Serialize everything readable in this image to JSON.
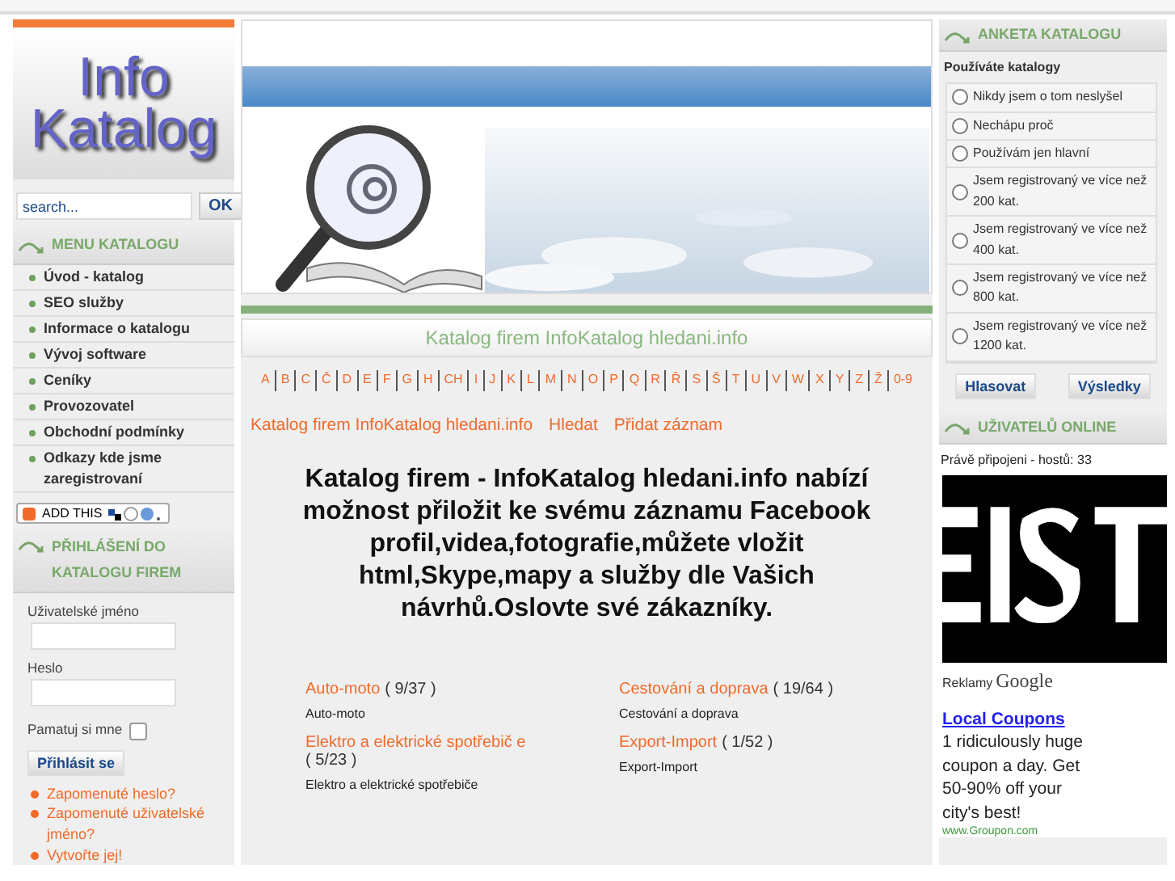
{
  "logo": {
    "line1": "Info",
    "line2": "Katalog"
  },
  "search": {
    "placeholder": "search...",
    "button": "OK"
  },
  "menu": {
    "title": "MENU KATALOGU",
    "items": [
      "Úvod - katalog",
      "SEO služby",
      "Informace o katalogu",
      "Vývoj software",
      "Ceníky",
      "Provozovatel",
      "Obchodní podmínky",
      "Odkazy kde jsme zaregistrovaní"
    ]
  },
  "addthis": {
    "label": "ADD THIS"
  },
  "login": {
    "title": "PŘIHLÁŠENÍ DO KATALOGU FIREM",
    "username_label": "Uživatelské jméno",
    "password_label": "Heslo",
    "remember_label": "Pamatuj si mne",
    "remember_checked": false,
    "submit": "Přihlásit se",
    "links": [
      "Zapomenuté heslo?",
      "Zapomenuté uživatelské jméno?",
      "Vytvořte jej!"
    ]
  },
  "page_title": "Katalog firem InfoKatalog hledani.info",
  "alphabet": [
    "A",
    "B",
    "C",
    "Č",
    "D",
    "E",
    "F",
    "G",
    "H",
    "CH",
    "I",
    "J",
    "K",
    "L",
    "M",
    "N",
    "O",
    "P",
    "Q",
    "R",
    "Ř",
    "S",
    "Š",
    "T",
    "U",
    "V",
    "W",
    "X",
    "Y",
    "Z",
    "Ž",
    "0-9"
  ],
  "nav": [
    "Katalog firem InfoKatalog hledani.info",
    "Hledat",
    "Přidat záznam"
  ],
  "intro": "Katalog firem - InfoKatalog hledani.info nabízí možnost přiložit ke svému záznamu Facebook profil,videa,fotografie,můžete vložit html,Skype,mapy a služby dle Vašich návrhů.Oslovte své zákazníky.",
  "categories": [
    {
      "name": "Auto-moto",
      "count": "( 9/37 )",
      "description": "Auto-moto"
    },
    {
      "name": "Cestování a doprava",
      "count": "( 19/64 )",
      "description": "Cestování a doprava"
    },
    {
      "name": "Elektro a elektrické spotřebič e",
      "count": "( 5/23 )",
      "description": "Elektro a elektrické spotřebiče"
    },
    {
      "name": "Export-Import",
      "count": "( 1/52 )",
      "description": "Export-Import"
    }
  ],
  "poll": {
    "title": "ANKETA KATALOGU",
    "question": "Používáte katalogy",
    "options": [
      {
        "label": "Nikdy jsem o tom neslyšel",
        "selected": false
      },
      {
        "label": "Nechápu proč",
        "selected": false
      },
      {
        "label": "Používám jen hlavní",
        "selected": false
      },
      {
        "label": "Jsem registrovaný ve více než 200 kat.",
        "selected": false
      },
      {
        "label": "Jsem registrovaný ve více než 400 kat.",
        "selected": false
      },
      {
        "label": "Jsem registrovaný ve více než 800 kat.",
        "selected": false
      },
      {
        "label": "Jsem registrovaný ve více než 1200 kat.",
        "selected": false
      }
    ],
    "vote": "Hlasovat",
    "results": "Výsledky"
  },
  "online": {
    "title": "UŽIVATELŮ ONLINE",
    "text": "Právě připojeni - hostů: 33"
  },
  "ad": {
    "label": "Reklamy",
    "brand": "Google",
    "headline": "Local Coupons",
    "body": "1 ridiculously huge coupon a day. Get 50-90% off your city's best!",
    "url": "www.Groupon.com"
  }
}
